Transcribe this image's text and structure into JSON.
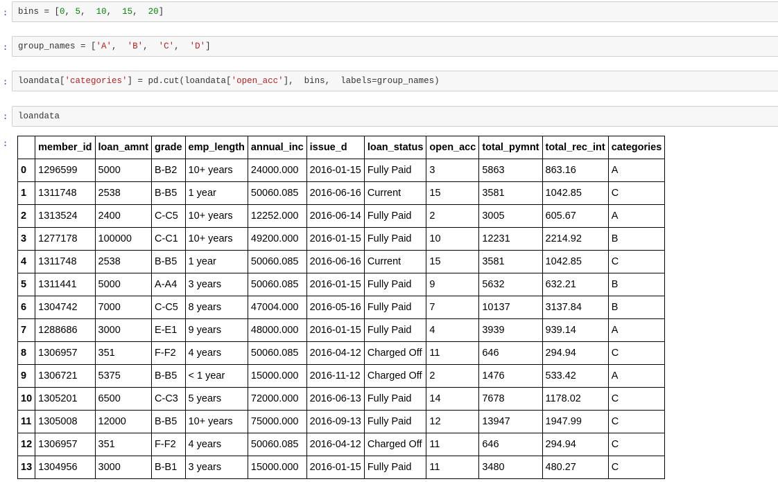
{
  "cells": [
    {
      "prompt": ":",
      "code": [
        {
          "t": "bins = [",
          "c": ""
        },
        {
          "t": "0",
          "c": "num"
        },
        {
          "t": ", ",
          "c": ""
        },
        {
          "t": "5",
          "c": "num"
        },
        {
          "t": ",  ",
          "c": ""
        },
        {
          "t": "10",
          "c": "num"
        },
        {
          "t": ",  ",
          "c": ""
        },
        {
          "t": "15",
          "c": "num"
        },
        {
          "t": ",  ",
          "c": ""
        },
        {
          "t": "20",
          "c": "num"
        },
        {
          "t": "]",
          "c": ""
        }
      ]
    },
    {
      "prompt": ":",
      "code": [
        {
          "t": "group_names = [",
          "c": ""
        },
        {
          "t": "'A'",
          "c": "str"
        },
        {
          "t": ",  ",
          "c": ""
        },
        {
          "t": "'B'",
          "c": "str"
        },
        {
          "t": ",  ",
          "c": ""
        },
        {
          "t": "'C'",
          "c": "str"
        },
        {
          "t": ",  ",
          "c": ""
        },
        {
          "t": "'D'",
          "c": "str"
        },
        {
          "t": "]",
          "c": ""
        }
      ]
    },
    {
      "prompt": ":",
      "code": [
        {
          "t": "loandata[",
          "c": ""
        },
        {
          "t": "'categories'",
          "c": "str"
        },
        {
          "t": "] = pd.cut(loandata[",
          "c": ""
        },
        {
          "t": "'open_acc'",
          "c": "str"
        },
        {
          "t": "],  bins,  labels=group_names)",
          "c": ""
        }
      ]
    },
    {
      "prompt": ":",
      "code": [
        {
          "t": "loandata",
          "c": ""
        }
      ]
    }
  ],
  "output_prompt": ":",
  "table": {
    "columns": [
      "",
      "member_id",
      "loan_amnt",
      "grade",
      "emp_length",
      "annual_inc",
      "issue_d",
      "loan_status",
      "open_acc",
      "total_pymnt",
      "total_rec_int",
      "categories"
    ],
    "rows": [
      [
        "0",
        "1296599",
        "5000",
        "B-B2",
        "10+ years",
        "24000.000",
        "2016-01-15",
        "Fully Paid",
        "3",
        "5863",
        "863.16",
        "A"
      ],
      [
        "1",
        "1311748",
        "2538",
        "B-B5",
        "1 year",
        "50060.085",
        "2016-06-16",
        "Current",
        "15",
        "3581",
        "1042.85",
        "C"
      ],
      [
        "2",
        "1313524",
        "2400",
        "C-C5",
        "10+ years",
        "12252.000",
        "2016-06-14",
        "Fully Paid",
        "2",
        "3005",
        "605.67",
        "A"
      ],
      [
        "3",
        "1277178",
        "100000",
        "C-C1",
        "10+ years",
        "49200.000",
        "2016-01-15",
        "Fully Paid",
        "10",
        "12231",
        "2214.92",
        "B"
      ],
      [
        "4",
        "1311748",
        "2538",
        "B-B5",
        "1 year",
        "50060.085",
        "2016-06-16",
        "Current",
        "15",
        "3581",
        "1042.85",
        "C"
      ],
      [
        "5",
        "1311441",
        "5000",
        "A-A4",
        "3 years",
        "50060.085",
        "2016-01-15",
        "Fully Paid",
        "9",
        "5632",
        "632.21",
        "B"
      ],
      [
        "6",
        "1304742",
        "7000",
        "C-C5",
        "8 years",
        "47004.000",
        "2016-05-16",
        "Fully Paid",
        "7",
        "10137",
        "3137.84",
        "B"
      ],
      [
        "7",
        "1288686",
        "3000",
        "E-E1",
        "9 years",
        "48000.000",
        "2016-01-15",
        "Fully Paid",
        "4",
        "3939",
        "939.14",
        "A"
      ],
      [
        "8",
        "1306957",
        "351",
        "F-F2",
        "4 years",
        "50060.085",
        "2016-04-12",
        "Charged Off",
        "11",
        "646",
        "294.94",
        "C"
      ],
      [
        "9",
        "1306721",
        "5375",
        "B-B5",
        "< 1 year",
        "15000.000",
        "2016-11-12",
        "Charged Off",
        "2",
        "1476",
        "533.42",
        "A"
      ],
      [
        "10",
        "1305201",
        "6500",
        "C-C3",
        "5 years",
        "72000.000",
        "2016-06-13",
        "Fully Paid",
        "14",
        "7678",
        "1178.02",
        "C"
      ],
      [
        "11",
        "1305008",
        "12000",
        "B-B5",
        "10+ years",
        "75000.000",
        "2016-09-13",
        "Fully Paid",
        "12",
        "13947",
        "1947.99",
        "C"
      ],
      [
        "12",
        "1306957",
        "351",
        "F-F2",
        "4 years",
        "50060.085",
        "2016-04-12",
        "Charged Off",
        "11",
        "646",
        "294.94",
        "C"
      ],
      [
        "13",
        "1304956",
        "3000",
        "B-B1",
        "3 years",
        "15000.000",
        "2016-01-15",
        "Fully Paid",
        "11",
        "3480",
        "480.27",
        "C"
      ]
    ]
  },
  "colors": {
    "input_bg": "#f7f7f7",
    "input_border": "#cfcfcf",
    "number": "#008800",
    "string": "#ba2121"
  }
}
